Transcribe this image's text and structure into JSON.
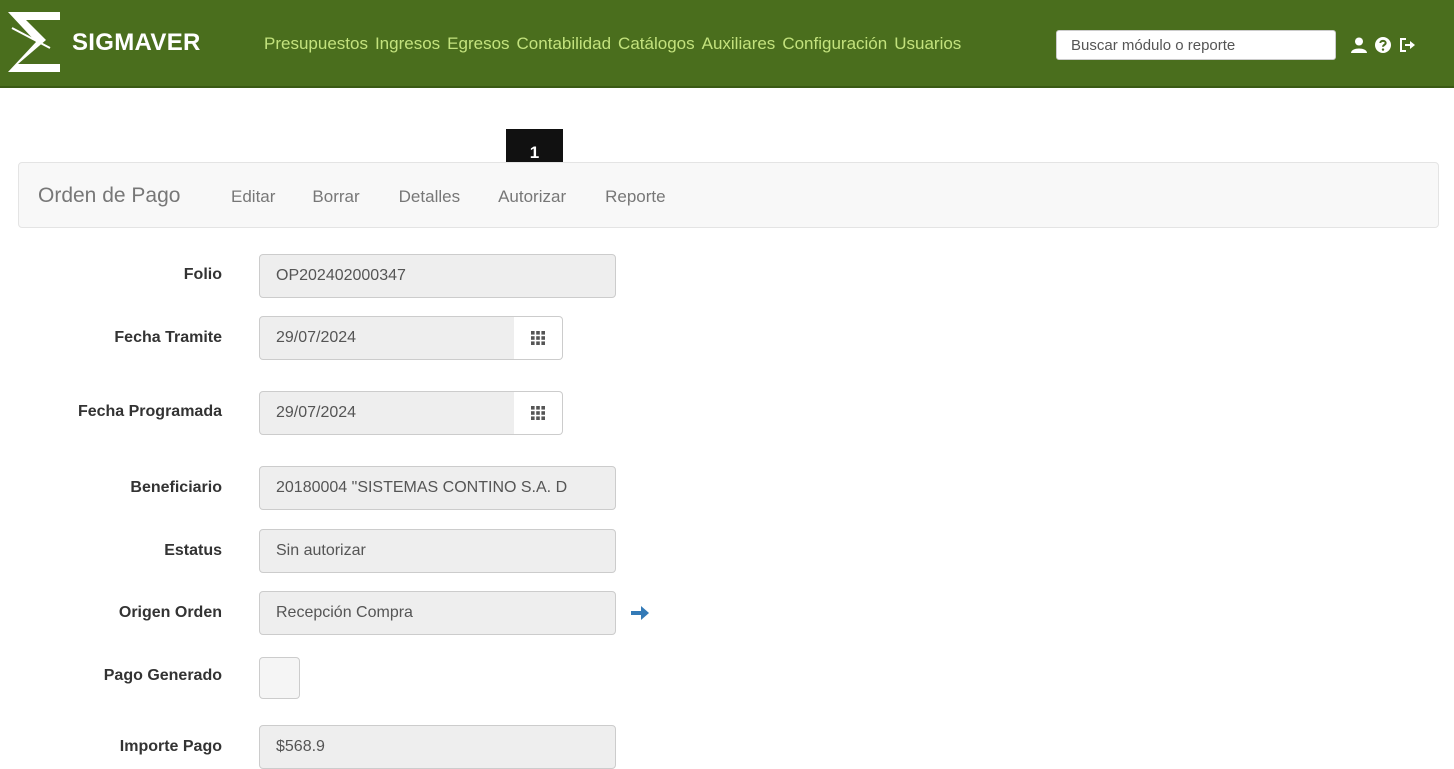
{
  "app": {
    "brand": "SIGMAVER",
    "search_placeholder": "Buscar módulo o reporte"
  },
  "nav": {
    "items": [
      {
        "label": "Presupuestos"
      },
      {
        "label": "Ingresos"
      },
      {
        "label": "Egresos"
      },
      {
        "label": "Contabilidad"
      },
      {
        "label": "Catálogos"
      },
      {
        "label": "Auxiliares"
      },
      {
        "label": "Configuración"
      },
      {
        "label": "Usuarios"
      }
    ],
    "icons": [
      "user-icon",
      "help-icon",
      "logout-icon"
    ]
  },
  "badge": {
    "number": "1"
  },
  "subnav": {
    "title": "Orden de Pago",
    "links": [
      {
        "label": "Editar"
      },
      {
        "label": "Borrar"
      },
      {
        "label": "Detalles"
      },
      {
        "label": "Autorizar"
      },
      {
        "label": "Reporte"
      }
    ]
  },
  "form": {
    "folio": {
      "label": "Folio",
      "value": "OP202402000347"
    },
    "fecha_tramite": {
      "label": "Fecha Tramite",
      "value": "29/07/2024"
    },
    "fecha_programada": {
      "label": "Fecha Programada",
      "value": "29/07/2024"
    },
    "beneficiario": {
      "label": "Beneficiario",
      "value": "20180004 \"SISTEMAS CONTINO S.A. D"
    },
    "estatus": {
      "label": "Estatus",
      "value": "Sin autorizar"
    },
    "origen_orden": {
      "label": "Origen Orden",
      "value": "Recepción Compra"
    },
    "pago_generado": {
      "label": "Pago Generado",
      "checked": false
    },
    "importe_pago": {
      "label": "Importe Pago",
      "value": "$568.9"
    }
  },
  "colors": {
    "navbar_bg": "#4a6e1d",
    "nav_link": "#c3e27d",
    "accent_arrow": "#337ab7"
  }
}
